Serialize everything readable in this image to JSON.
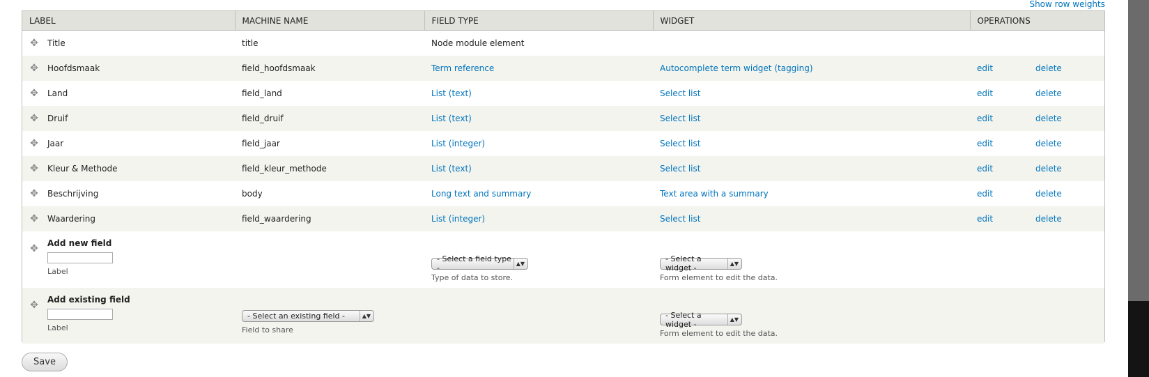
{
  "header_link": "Show row weights",
  "columns": [
    "LABEL",
    "MACHINE NAME",
    "FIELD TYPE",
    "WIDGET",
    "OPERATIONS"
  ],
  "rows": [
    {
      "label": "Title",
      "machine": "title",
      "type": "Node module element",
      "type_link": false,
      "widget": "",
      "edit": "",
      "delete": ""
    },
    {
      "label": "Hoofdsmaak",
      "machine": "field_hoofdsmaak",
      "type": "Term reference",
      "type_link": true,
      "widget": "Autocomplete term widget (tagging)",
      "edit": "edit",
      "delete": "delete"
    },
    {
      "label": "Land",
      "machine": "field_land",
      "type": "List (text)",
      "type_link": true,
      "widget": "Select list",
      "edit": "edit",
      "delete": "delete"
    },
    {
      "label": "Druif",
      "machine": "field_druif",
      "type": "List (text)",
      "type_link": true,
      "widget": "Select list",
      "edit": "edit",
      "delete": "delete"
    },
    {
      "label": "Jaar",
      "machine": "field_jaar",
      "type": "List (integer)",
      "type_link": true,
      "widget": "Select list",
      "edit": "edit",
      "delete": "delete"
    },
    {
      "label": "Kleur & Methode",
      "machine": "field_kleur_methode",
      "type": "List (text)",
      "type_link": true,
      "widget": "Select list",
      "edit": "edit",
      "delete": "delete"
    },
    {
      "label": "Beschrijving",
      "machine": "body",
      "type": "Long text and summary",
      "type_link": true,
      "widget": "Text area with a summary",
      "edit": "edit",
      "delete": "delete"
    },
    {
      "label": "Waardering",
      "machine": "field_waardering",
      "type": "List (integer)",
      "type_link": true,
      "widget": "Select list",
      "edit": "edit",
      "delete": "delete"
    }
  ],
  "add_new": {
    "title": "Add new field",
    "label_desc": "Label",
    "type_select": "- Select a field type -",
    "type_desc": "Type of data to store.",
    "widget_select": "- Select a widget -",
    "widget_desc": "Form element to edit the data."
  },
  "add_existing": {
    "title": "Add existing field",
    "label_desc": "Label",
    "field_select": "- Select an existing field -",
    "field_desc": "Field to share",
    "widget_select": "- Select a widget -",
    "widget_desc": "Form element to edit the data."
  },
  "save_label": "Save",
  "icons": {
    "drag": "drag-handle-icon",
    "select_arrow": "select-arrows-icon"
  }
}
